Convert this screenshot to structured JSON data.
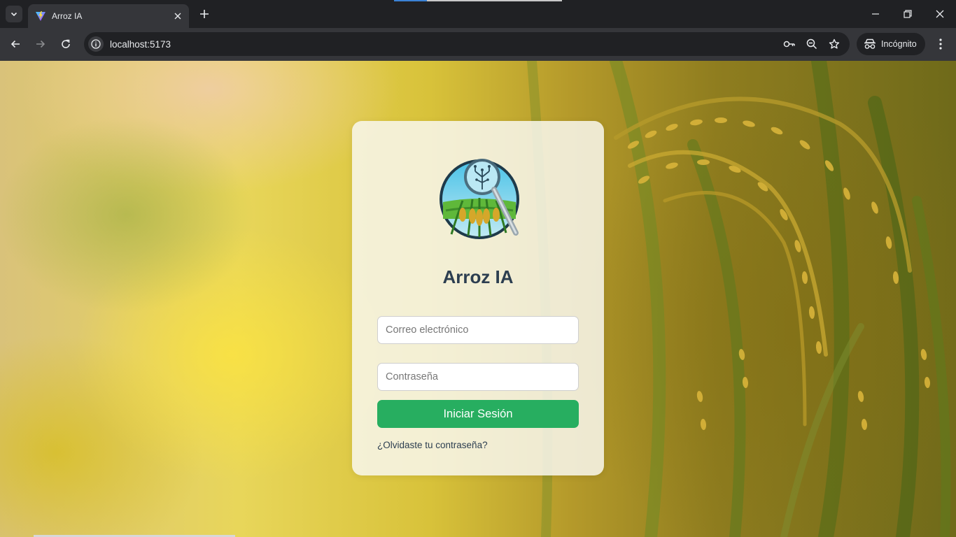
{
  "browser": {
    "tab_title": "Arroz IA",
    "url": "localhost:5173",
    "incognito_label": "Incógnito"
  },
  "login": {
    "app_title": "Arroz IA",
    "email_placeholder": "Correo electrónico",
    "email_value": "",
    "password_placeholder": "Contraseña",
    "password_value": "",
    "submit_label": "Iniciar Sesión",
    "forgot_link": "¿Olvidaste tu contraseña?"
  },
  "colors": {
    "primary_button": "#27ae60",
    "title_text": "#2c3e50",
    "chrome_dark": "#202124",
    "chrome_toolbar": "#35363a"
  },
  "icons": [
    "tab-search-icon",
    "vite-favicon-icon",
    "close-icon",
    "plus-icon",
    "minimize-icon",
    "restore-icon",
    "back-arrow-icon",
    "forward-arrow-icon",
    "reload-icon",
    "info-icon",
    "password-key-icon",
    "zoom-out-icon",
    "star-icon",
    "incognito-icon",
    "more-vert-icon",
    "rice-ai-logo"
  ]
}
